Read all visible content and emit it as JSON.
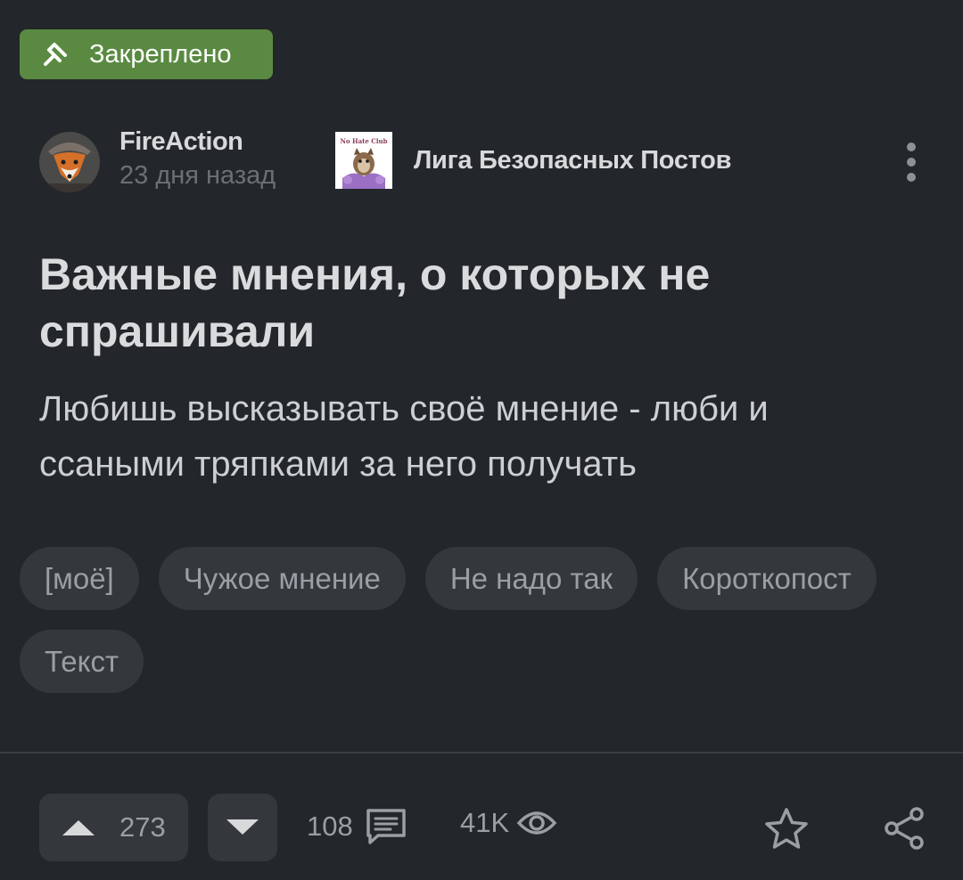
{
  "pinned_label": "Закреплено",
  "author": {
    "name": "FireAction",
    "time": "23 дня назад"
  },
  "community": {
    "name": "Лига Безопасных Постов",
    "logo_text": "No Hate Club"
  },
  "post": {
    "title": "Важные мнения, о которых не спрашивали",
    "text": "Любишь высказывать своё мнение - люби и ссаными тряпками за него получать"
  },
  "tags": [
    "[моё]",
    "Чужое мнение",
    "Не надо так",
    "Короткопост",
    "Текст"
  ],
  "stats": {
    "rating": "273",
    "comments": "108",
    "views": "41K"
  },
  "icons": {
    "pinned": "pin-icon",
    "more": "more-vertical-icon",
    "upvote": "triangle-up-icon",
    "downvote": "triangle-down-icon",
    "comments": "comment-icon",
    "views": "eye-icon",
    "save": "star-icon",
    "share": "share-icon"
  },
  "colors": {
    "background": "#23262a",
    "pinned_badge": "#5a8a42",
    "chip": "#34383c",
    "muted_text": "#9a9fa4"
  }
}
